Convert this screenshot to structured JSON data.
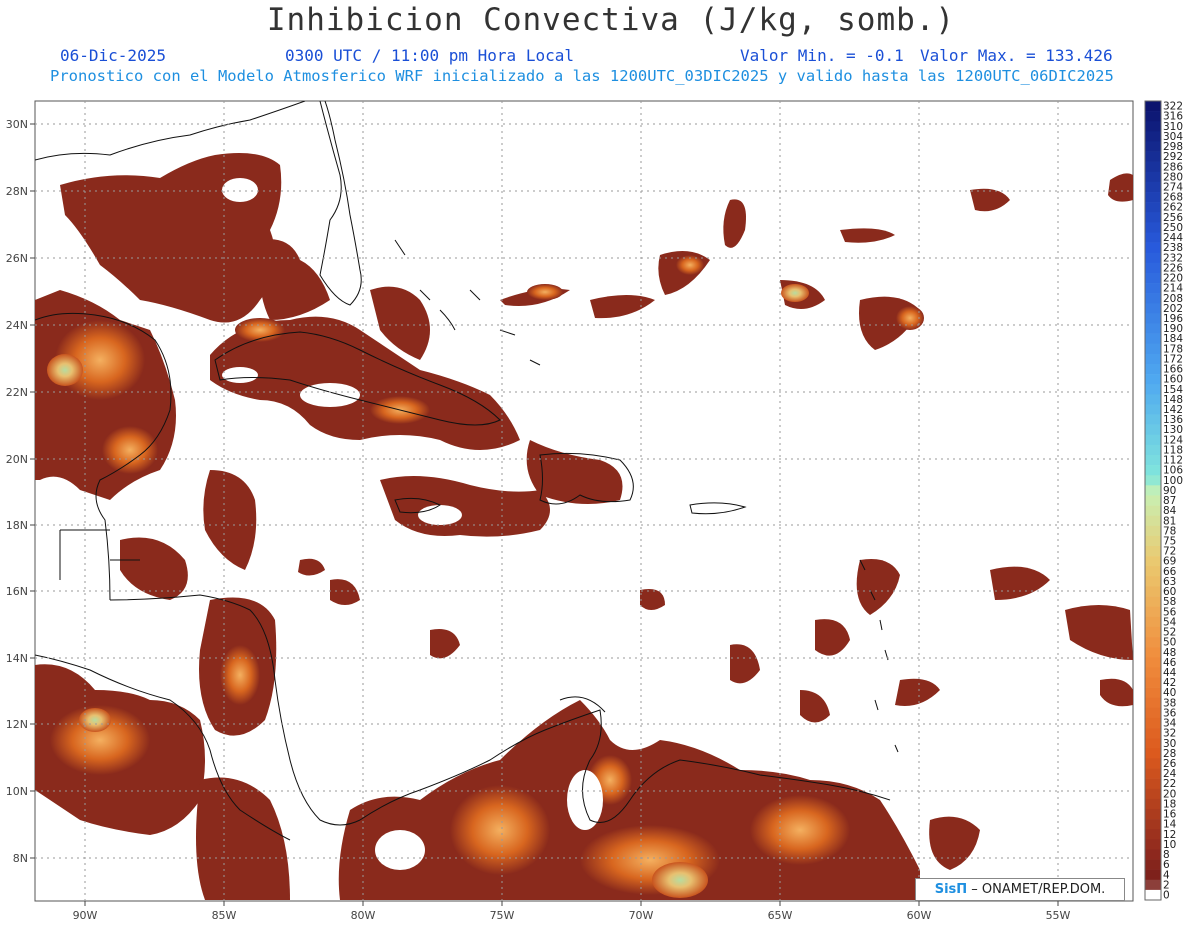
{
  "header": {
    "title": "Inhibicion Convectiva (J/kg, somb.)",
    "date": "06-Dic-2025",
    "time": "0300 UTC / 11:00 pm Hora Local",
    "min_label": "Valor Min. = -0.1",
    "max_label": "Valor Max. = 133.426",
    "model_line": "Pronostico con el Modelo Atmosferico WRF inicializado a las 1200UTC_03DIC2025 y valido hasta las  1200UTC_06DIC2025"
  },
  "map": {
    "lon_range": [
      -92.2,
      -49.8
    ],
    "lat_range": [
      6.7,
      30.6
    ],
    "lon_ticks": [
      "90W",
      "85W",
      "80W",
      "75W",
      "70W",
      "65W",
      "60W",
      "55W"
    ],
    "lat_ticks": [
      "30N",
      "28N",
      "26N",
      "24N",
      "22N",
      "20N",
      "18N",
      "16N",
      "14N",
      "12N",
      "10N",
      "8N"
    ],
    "grid": true,
    "field_colors": {
      "low": "#8a2a1c",
      "mid": "#c8541e",
      "high": "#f0a050",
      "peak": "#a6d7a0"
    }
  },
  "colorbar": {
    "labels": [
      "322",
      "316",
      "310",
      "304",
      "298",
      "292",
      "286",
      "280",
      "274",
      "268",
      "262",
      "256",
      "250",
      "244",
      "238",
      "232",
      "226",
      "220",
      "214",
      "208",
      "202",
      "196",
      "190",
      "184",
      "178",
      "172",
      "166",
      "160",
      "154",
      "148",
      "142",
      "136",
      "130",
      "124",
      "118",
      "112",
      "106",
      "100",
      "90",
      "87",
      "84",
      "81",
      "78",
      "75",
      "72",
      "69",
      "66",
      "63",
      "60",
      "58",
      "56",
      "54",
      "52",
      "50",
      "48",
      "46",
      "44",
      "42",
      "40",
      "38",
      "36",
      "34",
      "32",
      "30",
      "28",
      "26",
      "24",
      "22",
      "20",
      "18",
      "16",
      "14",
      "12",
      "10",
      "8",
      "6",
      "4",
      "2",
      "0"
    ]
  },
  "credit": {
    "brand": "SisΠ",
    "text": " – ONAMET/REP.DOM."
  }
}
